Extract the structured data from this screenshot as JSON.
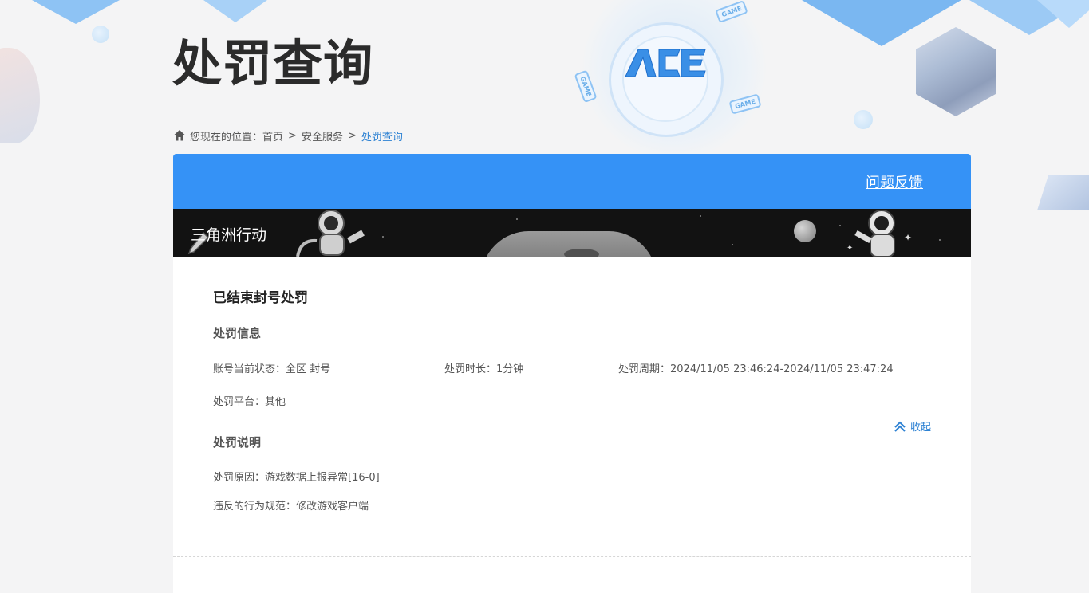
{
  "page": {
    "title": "处罚查询"
  },
  "breadcrumb": {
    "prefix": "您现在的位置：",
    "items": [
      "首页",
      "安全服务"
    ],
    "separator": ">",
    "current": "处罚查询"
  },
  "header": {
    "feedback_label": "问题反馈",
    "accent_color": "#3592f6"
  },
  "game": {
    "name": "三角洲行动"
  },
  "punishment": {
    "title": "已结束封号处罚",
    "info_section": {
      "title": "处罚信息",
      "status_label": "账号当前状态：",
      "status_value": "全区 封号",
      "duration_label": "处罚时长：",
      "duration_value": "1分钟",
      "period_label": "处罚周期：",
      "period_value": "2024/11/05 23:46:24-2024/11/05 23:47:24",
      "platform_label": "处罚平台：",
      "platform_value": "其他"
    },
    "desc_section": {
      "title": "处罚说明",
      "reason_label": "处罚原因：",
      "reason_value": "游戏数据上报异常[16-0]",
      "rule_label": "违反的行为规范：",
      "rule_value": "修改游戏客户端"
    },
    "collapse_label": "收起"
  },
  "icons": {
    "home": "home-icon",
    "collapse": "double-chevron-up-icon",
    "logo": "ace-logo"
  },
  "logo_text": "ACE",
  "game_tag_text": "GAME"
}
